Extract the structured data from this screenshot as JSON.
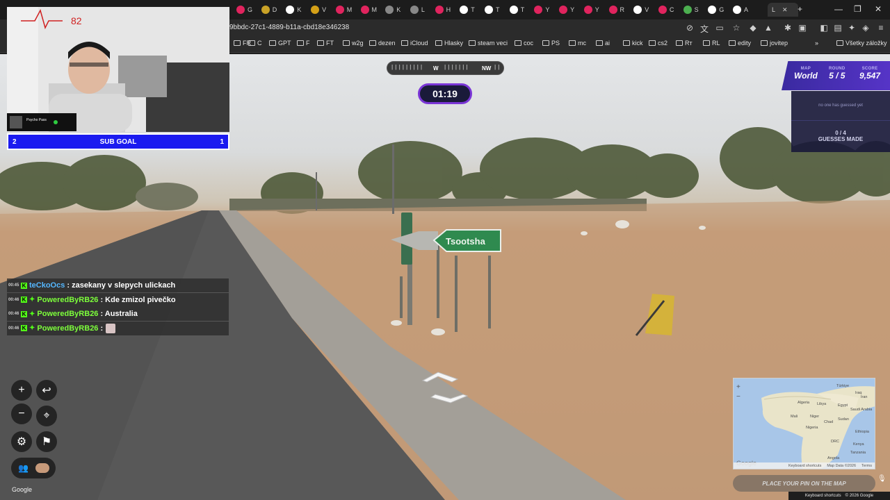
{
  "browser": {
    "tabs": [
      {
        "letter": "G",
        "color": "#e0245e"
      },
      {
        "letter": "D",
        "color": "#c9a227"
      },
      {
        "letter": "K",
        "color": "#ffffff"
      },
      {
        "letter": "V",
        "color": "#d4a017"
      },
      {
        "letter": "M",
        "color": "#e0245e"
      },
      {
        "letter": "M",
        "color": "#e0245e"
      },
      {
        "letter": "K",
        "color": "#888888"
      },
      {
        "letter": "L",
        "color": "#888888"
      },
      {
        "letter": "H",
        "color": "#e0245e"
      },
      {
        "letter": "T",
        "color": "#ffffff"
      },
      {
        "letter": "T",
        "color": "#ffffff"
      },
      {
        "letter": "T",
        "color": "#ffffff"
      },
      {
        "letter": "Y",
        "color": "#e0245e"
      },
      {
        "letter": "Y",
        "color": "#e0245e"
      },
      {
        "letter": "Y",
        "color": "#e0245e"
      },
      {
        "letter": "R",
        "color": "#e0245e"
      },
      {
        "letter": "V",
        "color": "#ffffff"
      },
      {
        "letter": "C",
        "color": "#e0245e"
      },
      {
        "letter": "S",
        "color": "#4caf50"
      },
      {
        "letter": "G",
        "color": "#ffffff"
      },
      {
        "letter": "A",
        "color": "#ffffff"
      }
    ],
    "active_tab_label": "L",
    "url": "9bbdc-27c1-4889-b11a-cbd18e346238",
    "bookmarks": [
      {
        "label": "FR"
      },
      {
        "label": "C"
      },
      {
        "label": "GPT"
      },
      {
        "label": "F"
      },
      {
        "label": "FT"
      },
      {
        "label": "w2g"
      },
      {
        "label": "dezen"
      },
      {
        "label": "iCloud"
      },
      {
        "label": "Hlasky"
      },
      {
        "label": "steam veci"
      },
      {
        "label": "coc"
      },
      {
        "label": "PS"
      },
      {
        "label": "mc"
      },
      {
        "label": "ai"
      },
      {
        "label": "kick"
      },
      {
        "label": "cs2"
      },
      {
        "label": "Rт"
      },
      {
        "label": "RL"
      },
      {
        "label": "edity"
      },
      {
        "label": "jovitep"
      }
    ],
    "all_bookmarks": "Všetky záložky"
  },
  "webcam": {
    "heart_rate": "82",
    "subgoal_left": "2",
    "subgoal_label": "SUB GOAL",
    "subgoal_right": "1"
  },
  "game": {
    "compass_w": "W",
    "compass_nw": "NW",
    "timer": "01:19",
    "map_label": "MAP",
    "map_value": "World",
    "round_label": "ROUND",
    "round_value": "5 / 5",
    "score_label": "SCORE",
    "score_value": "9,547",
    "nobody_guessed": "no one has guessed yet",
    "guesses_count": "0 / 4",
    "guesses_label": "GUESSES MADE",
    "place_pin": "PLACE YOUR PIN ON THE MAP",
    "sign_text": "Tsootsha",
    "google_logo": "Google"
  },
  "chat": [
    {
      "time": "00:45",
      "user": "teCkoOcs",
      "msg": ": zasekany v slepych ulickach",
      "color": "blue",
      "emote": false
    },
    {
      "time": "00:46",
      "user": "PoweredByRB26",
      "msg": ": Kde zmizol pivečko",
      "color": "green",
      "emote": false
    },
    {
      "time": "00:46",
      "user": "PoweredByRB26",
      "msg": ": Australia",
      "color": "green",
      "emote": false
    },
    {
      "time": "00:46",
      "user": "PoweredByRB26",
      "msg": ":",
      "color": "green",
      "emote": true
    }
  ],
  "minimap": {
    "labels": [
      "Türkiye",
      "Iraq",
      "Iran",
      "Algeria",
      "Libya",
      "Egypt",
      "Saudi Arabia",
      "Mali",
      "Niger",
      "Chad",
      "Sudan",
      "Nigeria",
      "Ethiopia",
      "DRC",
      "Kenya",
      "Tanzania",
      "Angola"
    ],
    "footer_shortcuts": "Keyboard shortcuts",
    "footer_data": "Map Data ©2026",
    "footer_terms": "Terms",
    "google": "Google"
  },
  "footer": {
    "shortcuts": "Keyboard shortcuts",
    "copyright": "© 2026 Google"
  }
}
